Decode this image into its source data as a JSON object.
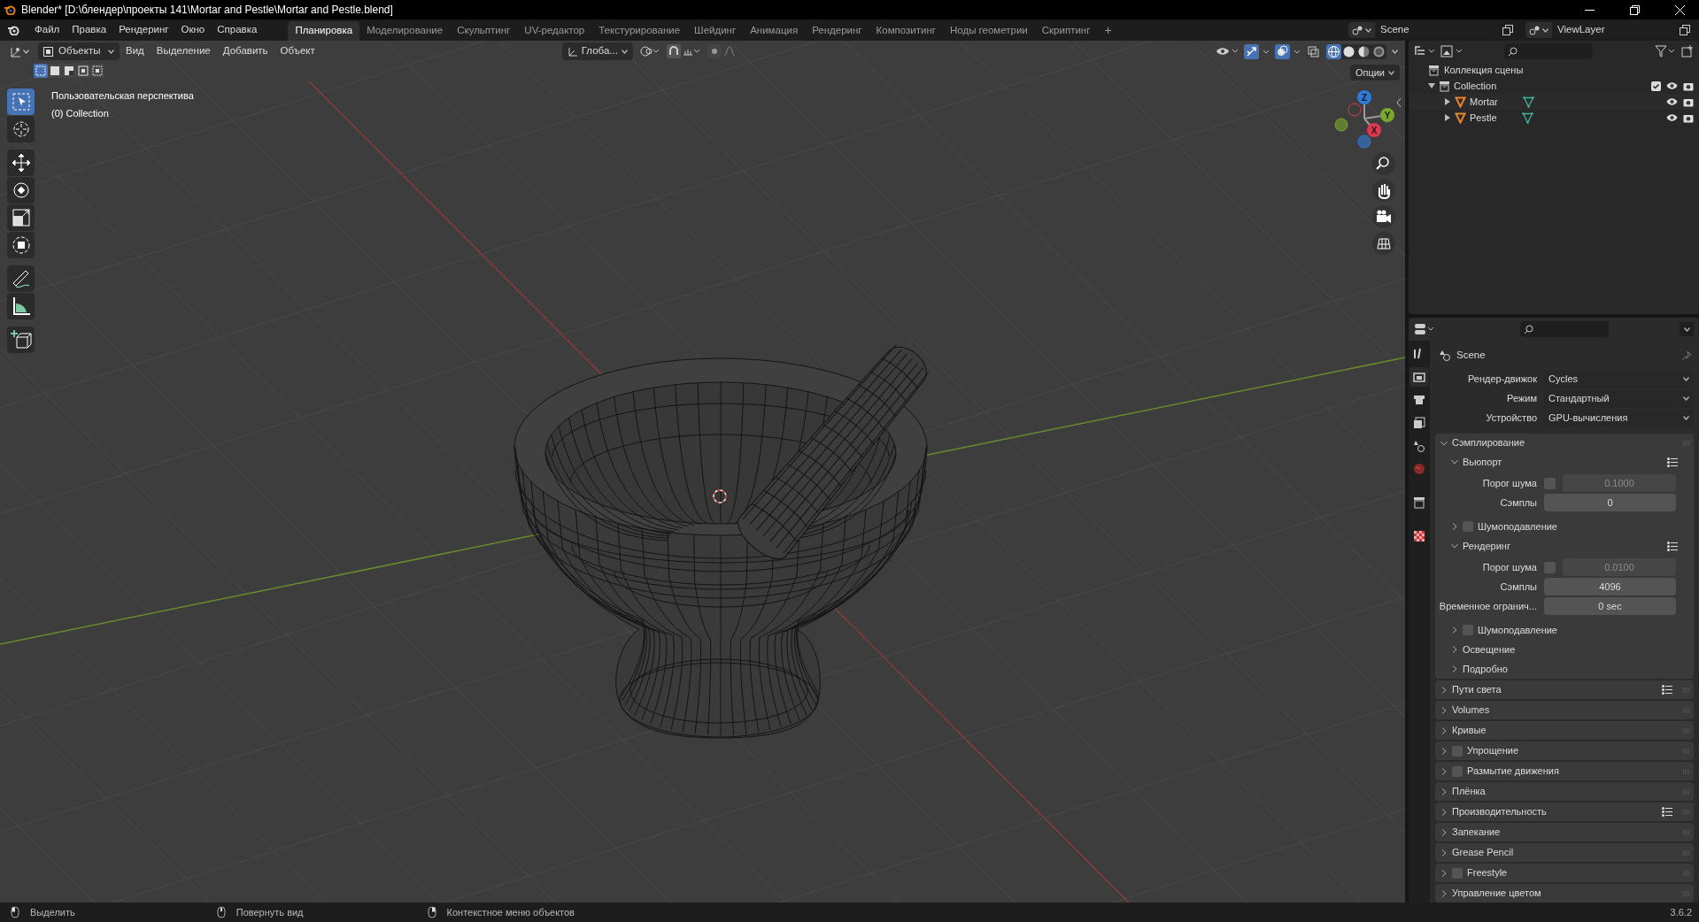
{
  "window": {
    "title": "Blender* [D:\\блендер\\проекты 141\\Mortar and Pestle\\Mortar and Pestle.blend]"
  },
  "menu": [
    "Файл",
    "Правка",
    "Рендеринг",
    "Окно",
    "Справка"
  ],
  "workspaces": [
    {
      "label": "Планировка",
      "selected": true
    },
    {
      "label": "Моделирование",
      "selected": false
    },
    {
      "label": "Скульптинг",
      "selected": false
    },
    {
      "label": "UV-редактор",
      "selected": false
    },
    {
      "label": "Текстурирование",
      "selected": false
    },
    {
      "label": "Шейдинг",
      "selected": false
    },
    {
      "label": "Анимация",
      "selected": false
    },
    {
      "label": "Рендеринг",
      "selected": false
    },
    {
      "label": "Композитинг",
      "selected": false
    },
    {
      "label": "Ноды геометрии",
      "selected": false
    },
    {
      "label": "Скриптинг",
      "selected": false
    }
  ],
  "add_workspace": "+",
  "scene": "Scene",
  "view_layer": "ViewLayer",
  "viewport": {
    "mode": "Объекты",
    "menus": [
      "Вид",
      "Выделение",
      "Добавить",
      "Объект"
    ],
    "orientation": "Глоба...",
    "options": "Опции",
    "selection_modes": [
      {
        "selected": true
      },
      {
        "selected": false
      },
      {
        "selected": false
      },
      {
        "selected": false
      },
      {
        "selected": false
      }
    ],
    "toggles": [
      {
        "kind": "gizmo",
        "on": true
      },
      {
        "kind": "overlay",
        "on": true
      },
      {
        "kind": "xray",
        "on": false
      }
    ],
    "shading_modes": [
      {
        "kind": "wireframe",
        "selected": true
      },
      {
        "kind": "solid",
        "selected": false
      },
      {
        "kind": "material",
        "selected": false
      },
      {
        "kind": "rendered",
        "selected": false
      }
    ],
    "overlay_title": "Пользовательская перспектива",
    "overlay_collection": "(0) Collection",
    "tool_groups": [
      [
        {
          "kind": "select",
          "selected": true
        },
        {
          "kind": "cursor",
          "selected": false
        }
      ],
      [
        {
          "kind": "move",
          "selected": false
        },
        {
          "kind": "rotate",
          "selected": false
        },
        {
          "kind": "scale",
          "selected": false
        },
        {
          "kind": "transform",
          "selected": false
        }
      ],
      [
        {
          "kind": "annotate",
          "selected": false
        },
        {
          "kind": "measure",
          "selected": false
        }
      ],
      [
        {
          "kind": "add_cube",
          "selected": false
        }
      ]
    ],
    "gizmo_axes": [
      "Z",
      "Y",
      "X"
    ]
  },
  "outliner": {
    "root": "Коллекция сцены",
    "items": [
      {
        "kind": "collection",
        "label": "Collection",
        "expanded": true,
        "checked": true,
        "children": [
          {
            "kind": "mesh",
            "label": "Mortar",
            "expanded": false
          },
          {
            "kind": "mesh",
            "label": "Pestle",
            "expanded": false
          }
        ]
      }
    ]
  },
  "properties": {
    "tabs": [
      {
        "kind": "tool",
        "selected": false
      },
      {
        "kind": "render",
        "selected": true
      },
      {
        "kind": "output",
        "selected": false
      },
      {
        "kind": "view_layer",
        "selected": false
      },
      {
        "kind": "scene",
        "selected": false
      },
      {
        "kind": "world",
        "selected": false
      },
      {
        "kind": "collection",
        "selected": false
      },
      {
        "kind": "texture",
        "selected": false
      }
    ],
    "title": "Scene",
    "fields": [
      {
        "label": "Рендер-движок",
        "value": "Cycles"
      },
      {
        "label": "Режим",
        "value": "Стандартный"
      },
      {
        "label": "Устройство",
        "value": "GPU-вычисления"
      }
    ],
    "sections": [
      {
        "kind": "plain",
        "label": "Сэмплирование",
        "expanded": true,
        "presets": false,
        "children": [
          {
            "kind": "plain",
            "label": "Вьюпорт",
            "expanded": true,
            "presets": true,
            "rows": [
              {
                "kind": "toggle_number",
                "label": "Порог шума",
                "checked": false,
                "value": "0.1000"
              },
              {
                "kind": "number",
                "label": "Сэмплы",
                "value": "0"
              }
            ]
          },
          {
            "kind": "toggle",
            "label": "Шумоподавление",
            "expanded": false,
            "presets": false,
            "checked": false
          },
          {
            "kind": "plain",
            "label": "Рендеринг",
            "expanded": true,
            "presets": true,
            "rows": [
              {
                "kind": "toggle_number",
                "label": "Порог шума",
                "checked": false,
                "value": "0.0100"
              },
              {
                "kind": "number",
                "label": "Сэмплы",
                "value": "4096"
              },
              {
                "kind": "number",
                "label": "Временное огранич...",
                "value": "0 sec"
              }
            ]
          },
          {
            "kind": "toggle",
            "label": "Шумоподавление",
            "expanded": false,
            "presets": false,
            "checked": false
          },
          {
            "kind": "plain",
            "label": "Освещение",
            "expanded": false,
            "presets": false
          },
          {
            "kind": "plain",
            "label": "Подробно",
            "expanded": false,
            "presets": false
          }
        ]
      },
      {
        "kind": "plain",
        "label": "Пути света",
        "expanded": false,
        "presets": true
      },
      {
        "kind": "plain",
        "label": "Volumes",
        "expanded": false,
        "presets": false
      },
      {
        "kind": "plain",
        "label": "Кривые",
        "expanded": false,
        "presets": false
      },
      {
        "kind": "toggle",
        "label": "Упрощение",
        "expanded": false,
        "presets": false,
        "checked": false
      },
      {
        "kind": "toggle",
        "label": "Размытие движения",
        "expanded": false,
        "presets": false,
        "checked": false
      },
      {
        "kind": "plain",
        "label": "Плёнка",
        "expanded": false,
        "presets": false
      },
      {
        "kind": "plain",
        "label": "Производительность",
        "expanded": false,
        "presets": true
      },
      {
        "kind": "plain",
        "label": "Запекание",
        "expanded": false,
        "presets": false
      },
      {
        "kind": "plain",
        "label": "Grease Pencil",
        "expanded": false,
        "presets": false
      },
      {
        "kind": "toggle",
        "label": "Freestyle",
        "expanded": false,
        "presets": false,
        "checked": false
      },
      {
        "kind": "plain",
        "label": "Управление цветом",
        "expanded": false,
        "presets": false
      }
    ]
  },
  "status_bar": {
    "items": [
      "Выделить",
      "Повернуть вид",
      "Контекстное меню объектов"
    ],
    "version": "3.6.2"
  }
}
